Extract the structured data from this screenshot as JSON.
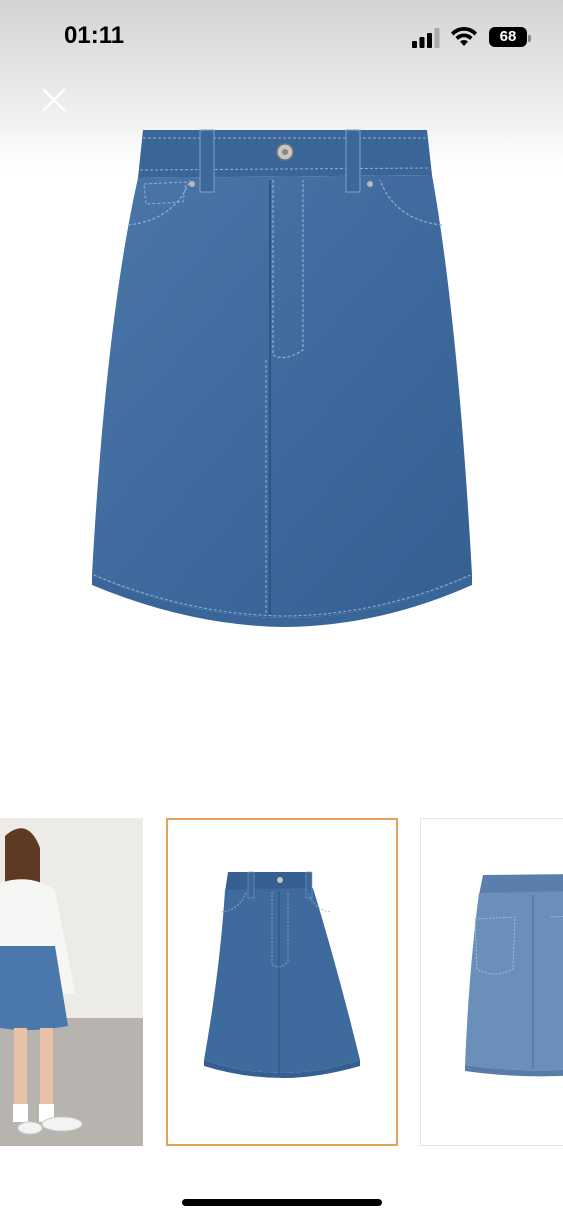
{
  "status_bar": {
    "time": "01:11",
    "battery_percent": "68",
    "icons": [
      "cellular-signal-icon",
      "wifi-icon",
      "battery-icon"
    ]
  },
  "viewer": {
    "close_icon": "close-icon",
    "selected_thumbnail": 1,
    "thumbnails": [
      {
        "name": "model-back-view"
      },
      {
        "name": "skirt-front-view"
      },
      {
        "name": "skirt-back-view"
      }
    ]
  },
  "colors": {
    "denim": "#3e6a9e",
    "denim_dark": "#2f5684",
    "denim_light": "#5d86b6",
    "selected_border": "#e3a15a"
  }
}
